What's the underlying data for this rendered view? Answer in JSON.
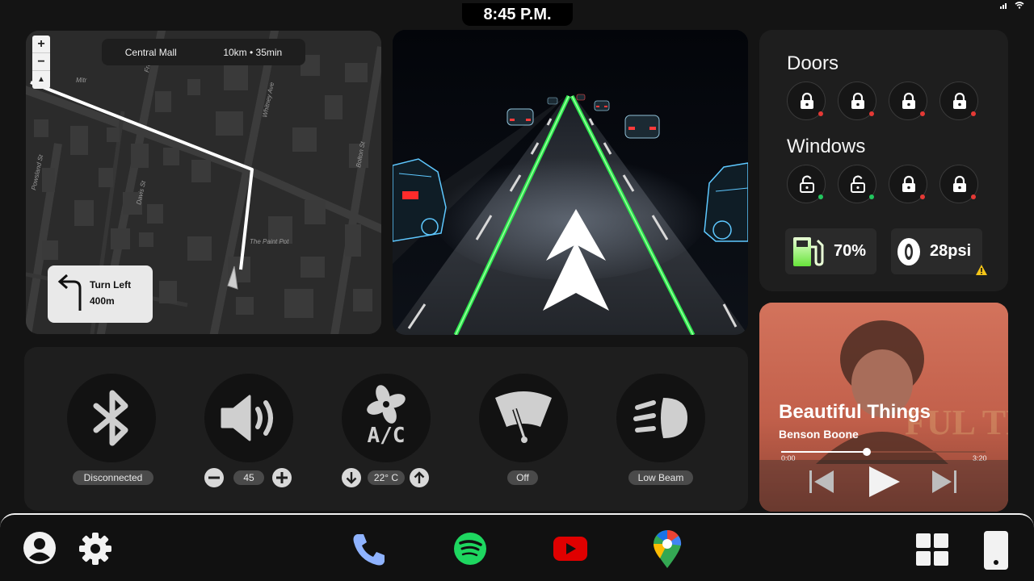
{
  "status_bar": {
    "time": "8:45 P.M."
  },
  "navigation": {
    "destination": "Central Mall",
    "distance_eta": "10km • 35min",
    "zoom_in": "+",
    "zoom_out": "−",
    "turn": {
      "instruction": "Turn Left",
      "distance": "400m"
    },
    "street_labels": [
      "Mitr",
      "Whitney Ave",
      "Powsland St",
      "Davis St",
      "Bolton St",
      "The Paint Pot",
      "Franklin St"
    ]
  },
  "vehicle": {
    "doors_title": "Doors",
    "windows_title": "Windows",
    "doors": [
      "locked",
      "locked",
      "locked",
      "locked"
    ],
    "windows": [
      "unlocked",
      "unlocked",
      "locked",
      "locked"
    ],
    "fuel": "70%",
    "tire_pressure": "28psi",
    "status_colors": {
      "locked": "#e53935",
      "unlocked": "#22c55e",
      "warning": "#f5c518"
    }
  },
  "controls": {
    "bluetooth": {
      "status": "Disconnected"
    },
    "volume": {
      "value": "45"
    },
    "ac": {
      "label": "A/C",
      "temperature": "22° C"
    },
    "wipers": {
      "status": "Off"
    },
    "headlights": {
      "status": "Low Beam"
    }
  },
  "music": {
    "title": "Beautiful Things",
    "artist": "Benson Boone",
    "elapsed": "0:00",
    "duration": "3:20",
    "progress": 0.42
  },
  "dock": {
    "apps": [
      "phone",
      "spotify",
      "youtube",
      "google-maps"
    ],
    "colors": {
      "phone": "#8fb3ff",
      "spotify": "#1ed760",
      "youtube": "#e00000"
    }
  }
}
